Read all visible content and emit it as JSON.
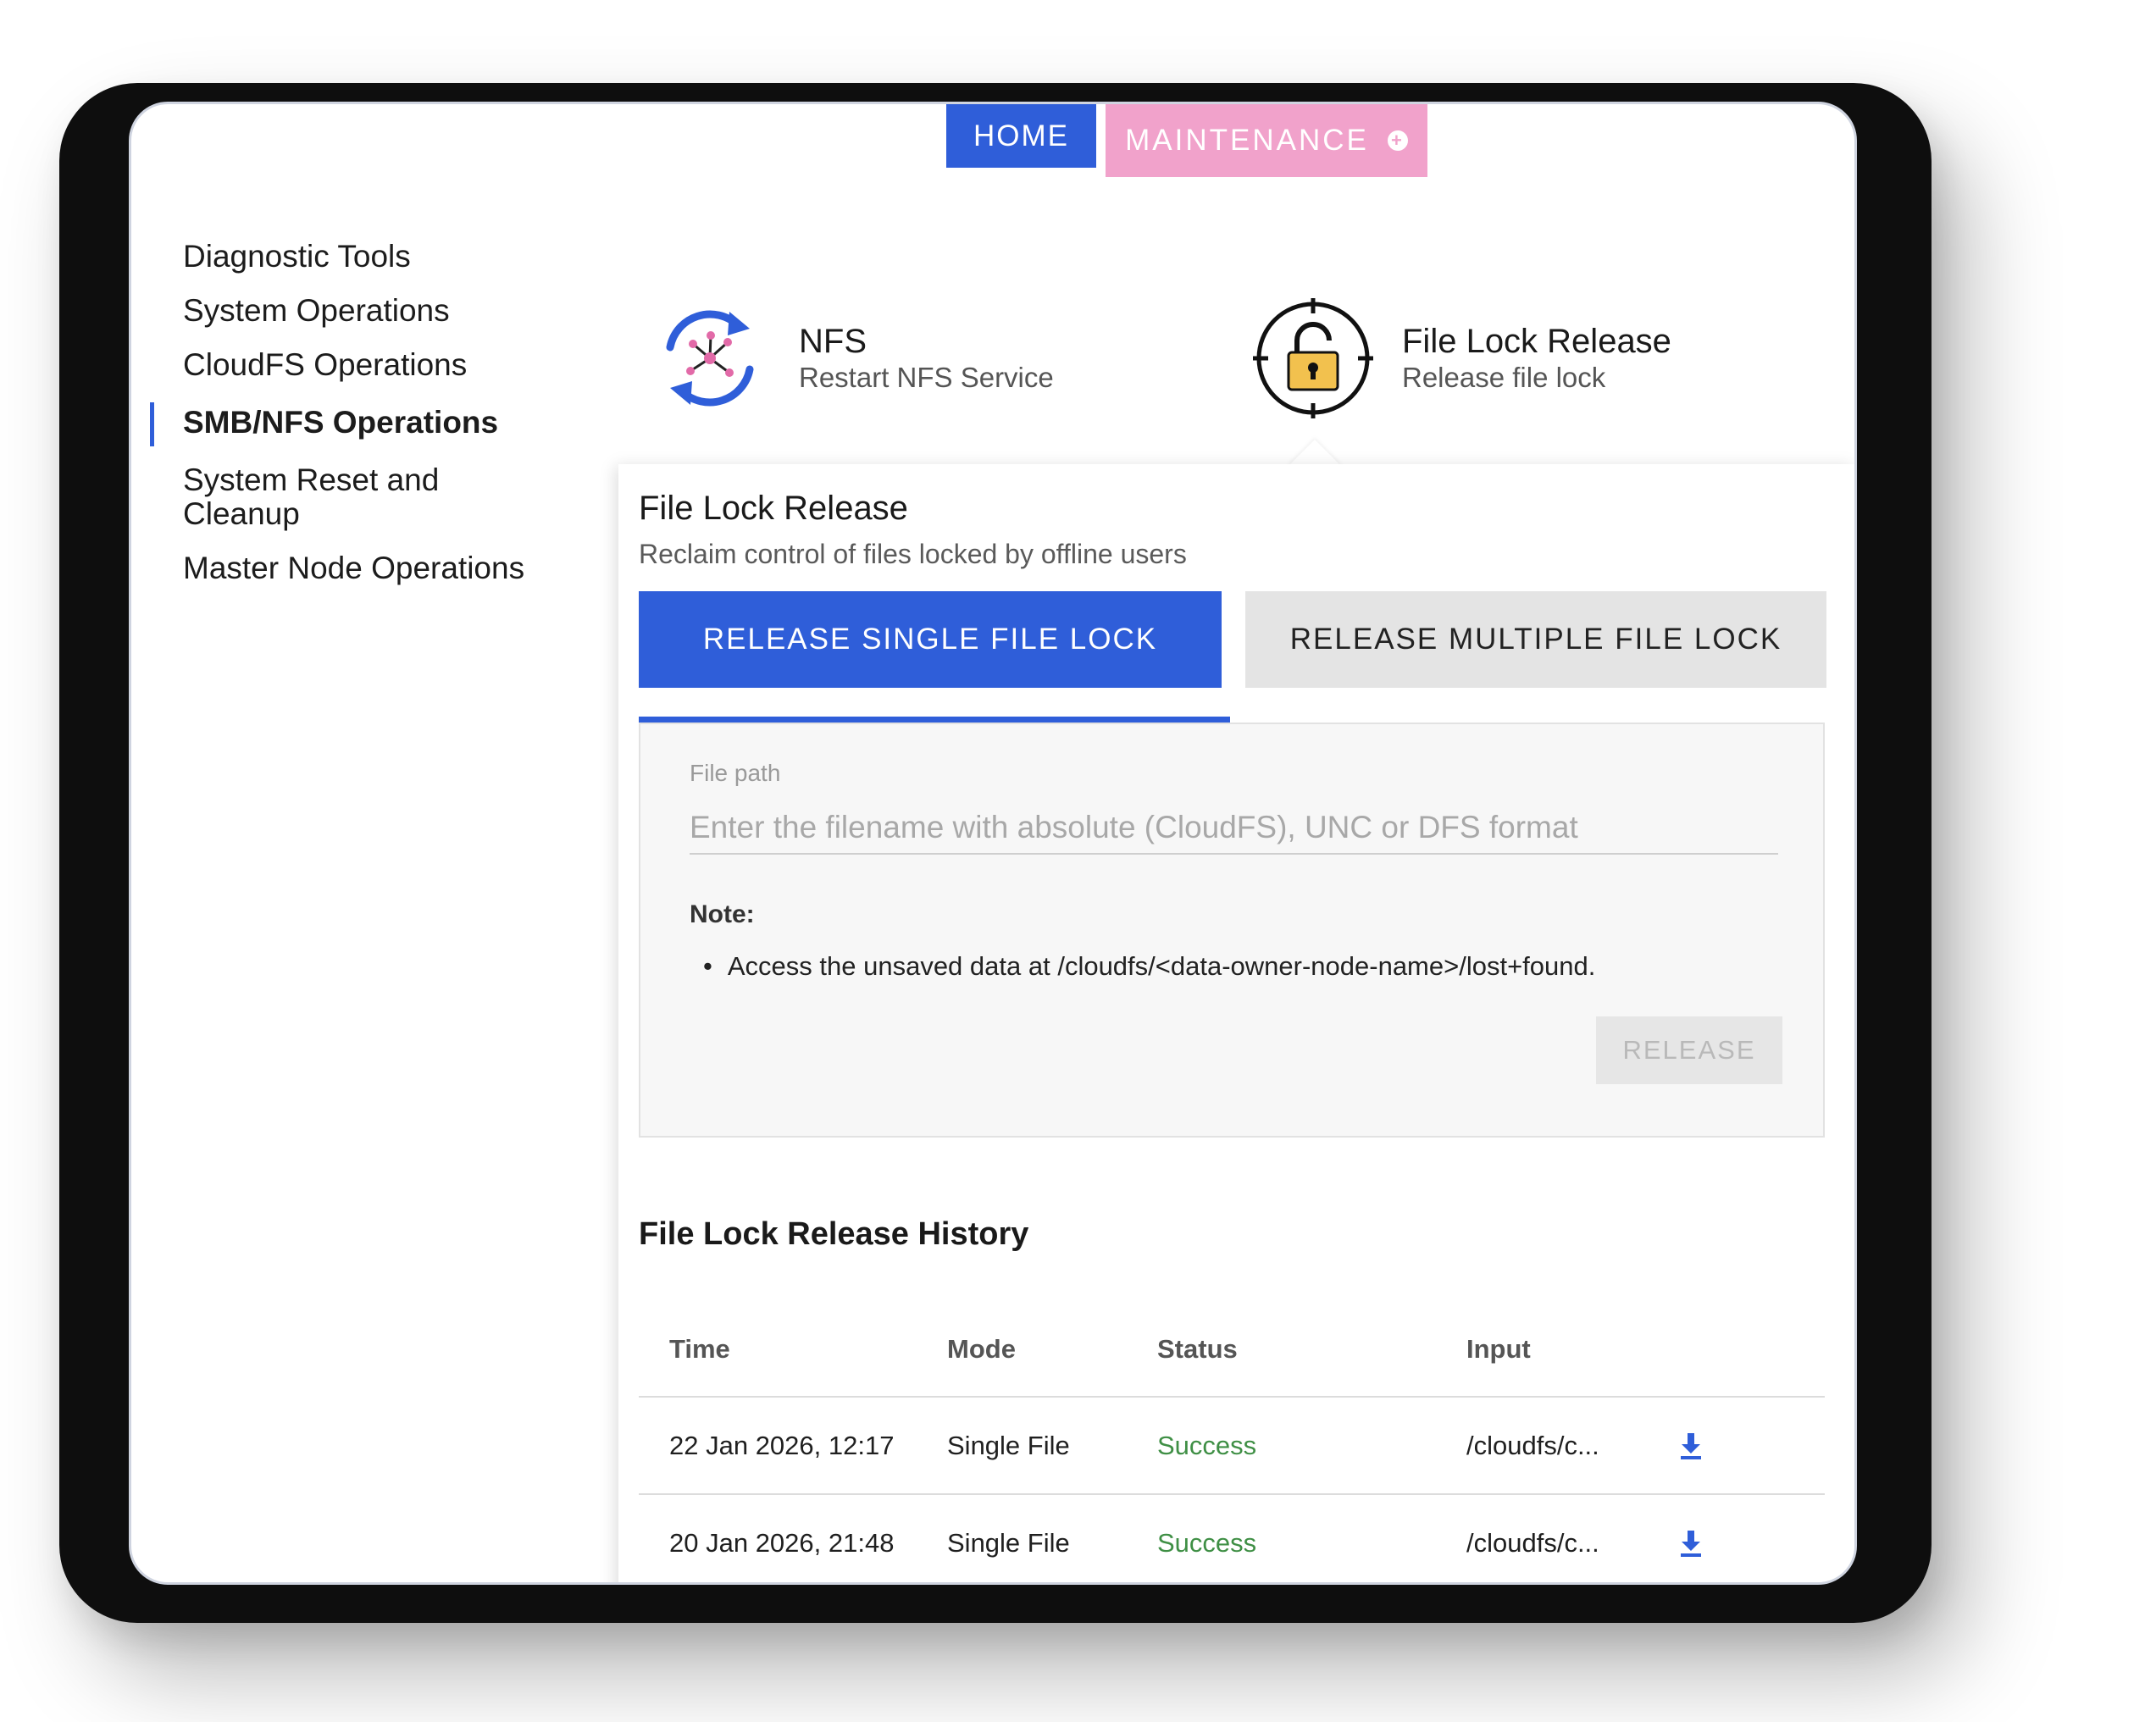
{
  "nav": {
    "home_label": "HOME",
    "maintenance_label": "MAINTENANCE"
  },
  "sidebar": {
    "items": [
      {
        "label": "Diagnostic Tools"
      },
      {
        "label": "System Operations"
      },
      {
        "label": "CloudFS Operations"
      },
      {
        "label": "SMB/NFS Operations",
        "active": true
      },
      {
        "label": "System Reset and Cleanup"
      },
      {
        "label": "Master Node Operations"
      }
    ]
  },
  "cards": {
    "nfs": {
      "title": "NFS",
      "subtitle": "Restart NFS Service",
      "icon": "refresh-icon"
    },
    "lock": {
      "title": "File Lock Release",
      "subtitle": "Release file lock",
      "icon": "padlock-icon"
    }
  },
  "panel": {
    "title": "File Lock Release",
    "subtitle": "Reclaim control of files locked by offline users",
    "tabs": {
      "single_label": "RELEASE SINGLE FILE LOCK",
      "multiple_label": "RELEASE MULTIPLE FILE LOCK"
    },
    "form": {
      "file_path_label": "File path",
      "file_path_placeholder": "Enter the filename with absolute (CloudFS), UNC or DFS format",
      "file_path_value": "",
      "note_heading": "Note:",
      "note_item": "Access the unsaved data at /cloudfs/<data-owner-node-name>/lost+found.",
      "release_label": "RELEASE"
    },
    "history": {
      "title": "File Lock Release History",
      "columns": {
        "time": "Time",
        "mode": "Mode",
        "status": "Status",
        "input": "Input"
      },
      "rows": [
        {
          "time": "22 Jan 2026, 12:17",
          "mode": "Single File",
          "status": "Success",
          "input": "/cloudfs/c..."
        },
        {
          "time": "20 Jan 2026, 21:48",
          "mode": "Single File",
          "status": "Success",
          "input": "/cloudfs/c..."
        }
      ]
    }
  },
  "colors": {
    "primary": "#2f5ed9",
    "maintenance": "#f1a2cb",
    "success": "#3f8f45",
    "lock_body": "#f2c14e"
  }
}
